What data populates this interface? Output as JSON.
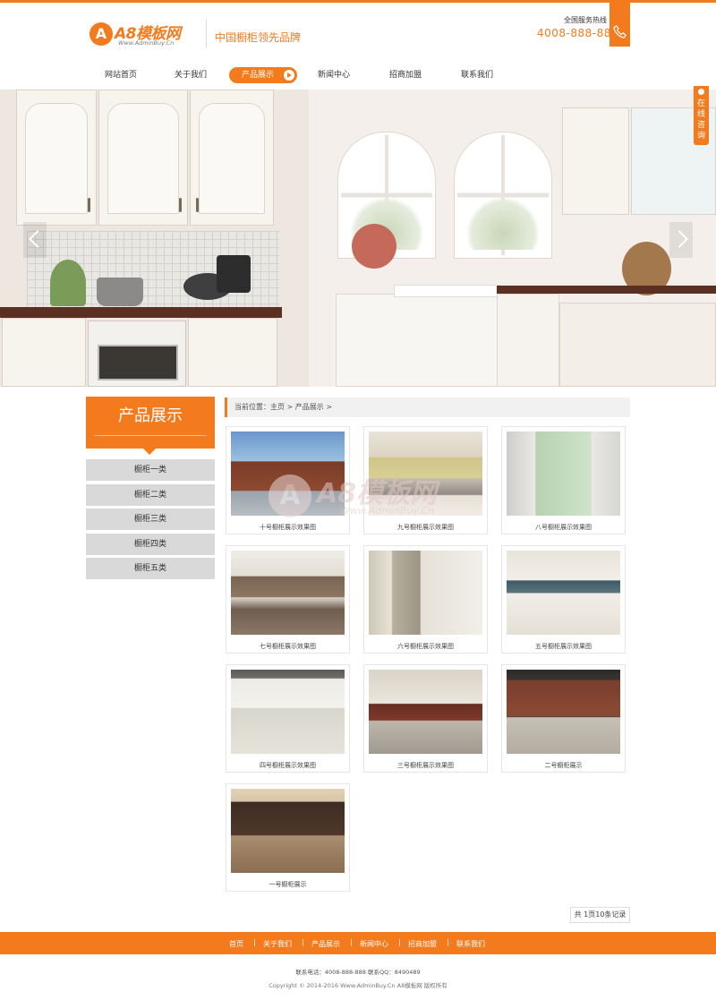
{
  "header": {
    "logo_letter": "A",
    "logo_text": "A8模板网",
    "logo_sub": "Www.AdminBuy.Cn",
    "slogan": "中国橱柜领先品牌",
    "hotline_label": "全国服务热线",
    "hotline_number": "4008-888-888",
    "phone_icon": "phone-icon"
  },
  "nav": {
    "items": [
      {
        "label": "网站首页",
        "active": false
      },
      {
        "label": "关于我们",
        "active": false
      },
      {
        "label": "产品展示",
        "active": true
      },
      {
        "label": "新闻中心",
        "active": false
      },
      {
        "label": "招商加盟",
        "active": false
      },
      {
        "label": "联系我们",
        "active": false
      }
    ]
  },
  "banner": {
    "slide_count": 2,
    "current_slide": 2,
    "consult_label": "在线咨询"
  },
  "sidebar": {
    "title": "产品展示",
    "items": [
      "橱柜一类",
      "橱柜二类",
      "橱柜三类",
      "橱柜四类",
      "橱柜五类"
    ]
  },
  "breadcrumb": "当前位置：主页 > 产品展示 >",
  "products": [
    {
      "caption": "十号橱柜展示效果图"
    },
    {
      "caption": "九号橱柜展示效果图"
    },
    {
      "caption": "八号橱柜展示效果图"
    },
    {
      "caption": "七号橱柜展示效果图"
    },
    {
      "caption": "六号橱柜展示效果图"
    },
    {
      "caption": "五号橱柜展示效果图"
    },
    {
      "caption": "四号橱柜展示效果图"
    },
    {
      "caption": "三号橱柜展示效果图"
    },
    {
      "caption": "二号橱柜展示"
    },
    {
      "caption": "一号橱柜展示"
    }
  ],
  "watermark": {
    "letter": "A",
    "text": "A8模板网",
    "sub": "Www.AdminBuy.Cn"
  },
  "pagination": "共 1页10条记录",
  "footer": {
    "links": [
      "首页",
      "关于我们",
      "产品展示",
      "新闻中心",
      "招商加盟",
      "联系我们"
    ],
    "separator": "|",
    "contact": "联系电话：4008-888-888    联系QQ：8490489",
    "copyright": "Copyright © 2014-2016 Www.AdminBuy.Cn A8模板网 版权所有"
  },
  "colors": {
    "accent": "#f37b1d",
    "sidebar_item": "#d9d9d9",
    "crumb_bg": "#f1f1f1"
  }
}
